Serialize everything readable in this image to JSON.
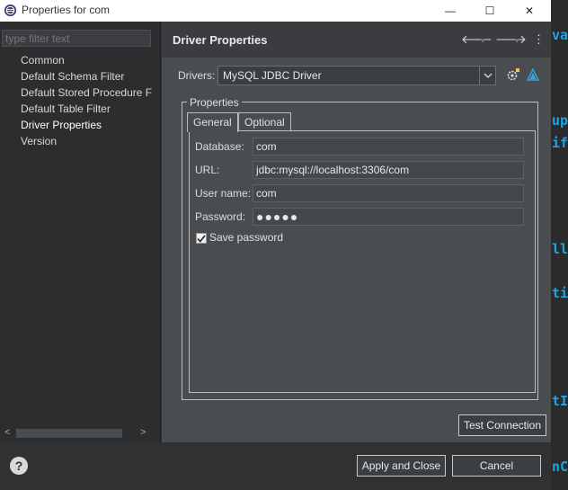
{
  "window": {
    "title": "Properties for com",
    "minimize_glyph": "—",
    "maximize_glyph": "☐",
    "close_glyph": "✕"
  },
  "background_editor": {
    "fragments": [
      "va",
      "up",
      "if",
      "ll",
      "ti",
      "tI",
      "nC"
    ]
  },
  "left_pane": {
    "filter_placeholder": "type filter text",
    "items": [
      {
        "label": "Common"
      },
      {
        "label": "Default Schema Filter"
      },
      {
        "label": "Default Stored Procedure F"
      },
      {
        "label": "Default Table Filter"
      },
      {
        "label": "Driver Properties",
        "selected": true
      },
      {
        "label": "Version"
      }
    ],
    "scroll_left": "<",
    "scroll_right": ">"
  },
  "right_pane": {
    "title": "Driver Properties",
    "back_icon": "🡐",
    "forward_icon": "🡒",
    "dropdown_glyph": "▾",
    "menu_glyph": "⋮",
    "drivers_label": "Drivers:",
    "driver_selected": "MySQL JDBC Driver",
    "properties_group": "Properties",
    "tabs": [
      {
        "label": "General",
        "active": true
      },
      {
        "label": "Optional",
        "active": false
      }
    ],
    "fields": {
      "database_label": "Database:",
      "database_value": "com",
      "url_label": "URL:",
      "url_value": "jdbc:mysql://localhost:3306/com",
      "username_label": "User name:",
      "username_value": "com",
      "password_label": "Password:",
      "password_value": "●●●●●"
    },
    "save_password_label": "Save password",
    "save_password_checked": true,
    "test_connection_label": "Test Connection"
  },
  "bottom": {
    "help_glyph": "?",
    "apply_close_label": "Apply and Close",
    "cancel_label": "Cancel"
  },
  "colors": {
    "accent_blue": "#1aa6e8",
    "dialog_bg": "#2f3133",
    "panel_bg": "#4a4d50"
  }
}
